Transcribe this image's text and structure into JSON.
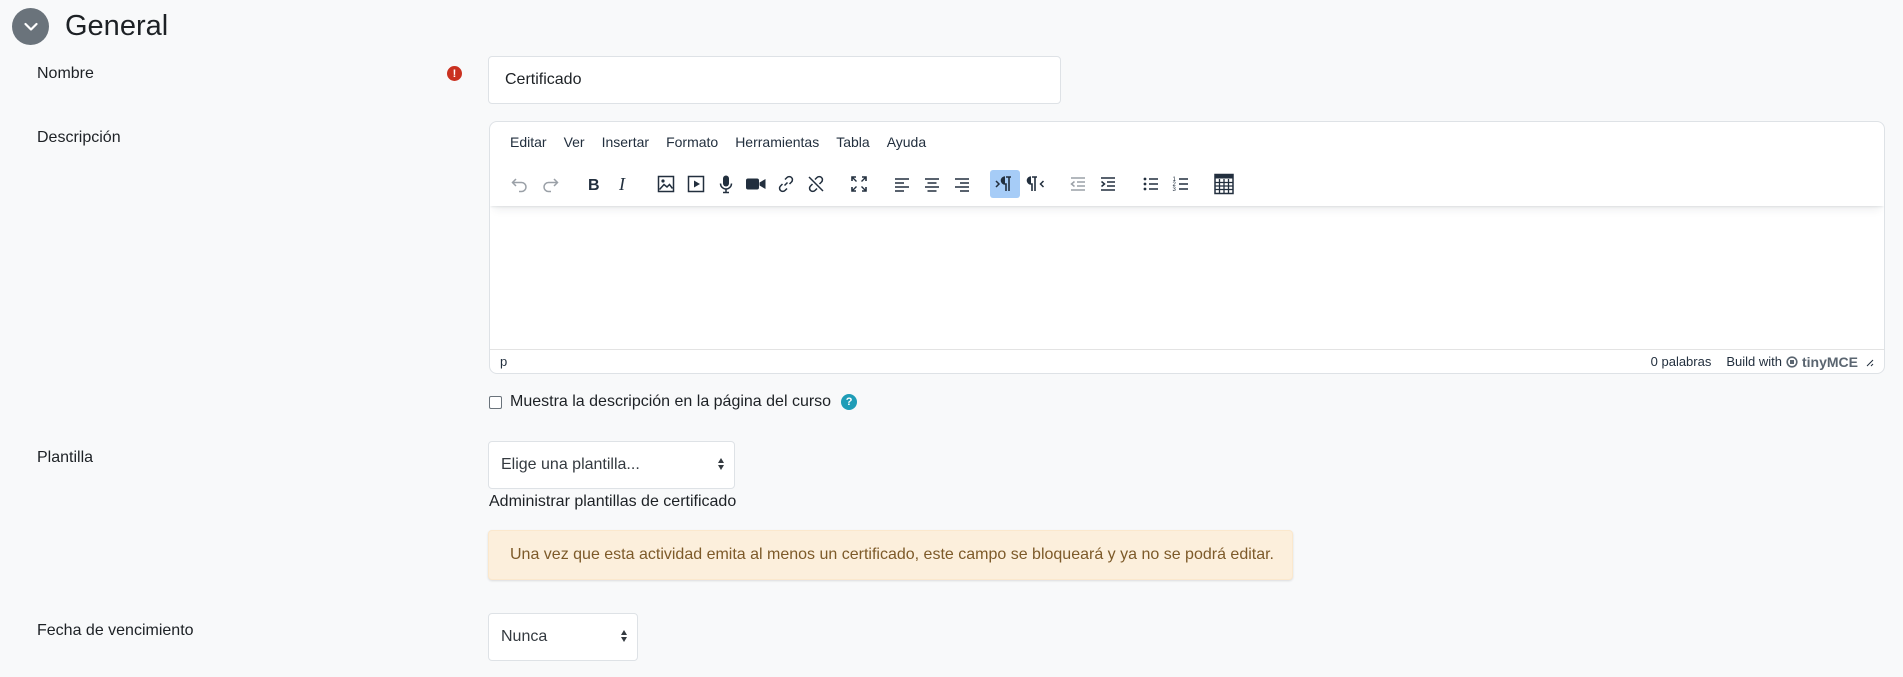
{
  "section": {
    "title": "General"
  },
  "fields": {
    "nombre": {
      "label": "Nombre",
      "value": "Certificado"
    },
    "descripcion": {
      "label": "Descripción"
    },
    "plantilla": {
      "label": "Plantilla",
      "selected": "Elige una plantilla...",
      "manage_link": "Administrar plantillas de certificado"
    },
    "vencimiento": {
      "label": "Fecha de vencimiento",
      "selected": "Nunca"
    }
  },
  "editor": {
    "menu": [
      "Editar",
      "Ver",
      "Insertar",
      "Formato",
      "Herramientas",
      "Tabla",
      "Ayuda"
    ],
    "status_path": "p",
    "wordcount": "0 palabras",
    "branding_prefix": "Build with",
    "branding_logo": "tinyMCE"
  },
  "show_description": {
    "label": "Muestra la descripción en la página del curso"
  },
  "alert": {
    "text": "Una vez que esta actividad emita al menos un certificado, este campo se bloqueará y ya no se podrá editar."
  },
  "colors": {
    "required": "#ca3120",
    "help": "#1f9db7",
    "alert_bg": "#fcefdc",
    "active_button": "#a6ccf7"
  }
}
